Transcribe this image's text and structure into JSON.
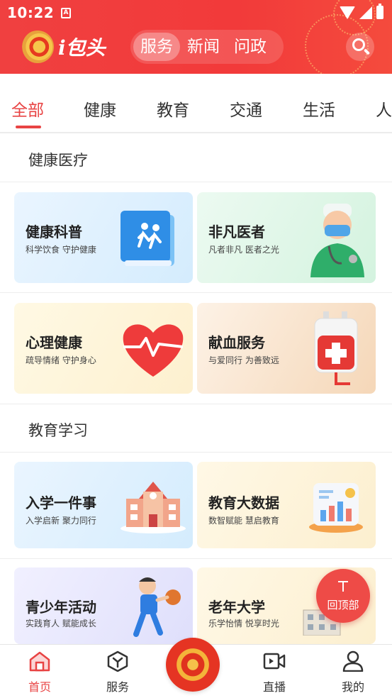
{
  "status_bar": {
    "time": "10:22",
    "notif_badge": "A"
  },
  "header": {
    "logo_text": "i包头",
    "tabs": [
      {
        "label": "服务",
        "active": true
      },
      {
        "label": "新闻",
        "active": false
      },
      {
        "label": "问政",
        "active": false
      }
    ]
  },
  "categories": [
    {
      "label": "全部",
      "active": true
    },
    {
      "label": "健康",
      "active": false
    },
    {
      "label": "教育",
      "active": false
    },
    {
      "label": "交通",
      "active": false
    },
    {
      "label": "生活",
      "active": false
    },
    {
      "label": "人",
      "active": false
    }
  ],
  "sections": {
    "health": {
      "title": "健康医疗",
      "cards": [
        {
          "title": "健康科普",
          "subtitle": "科学饮食  守护健康"
        },
        {
          "title": "非凡医者",
          "subtitle": "凡者非凡    医者之光"
        },
        {
          "title": "心理健康",
          "subtitle": "疏导情绪  守护身心"
        },
        {
          "title": "献血服务",
          "subtitle": "与爱同行  为善致远"
        }
      ]
    },
    "education": {
      "title": "教育学习",
      "cards": [
        {
          "title": "入学一件事",
          "subtitle": "入学启新  聚力同行"
        },
        {
          "title": "教育大数据",
          "subtitle": "数智赋能  慧启教育"
        },
        {
          "title": "青少年活动",
          "subtitle": "实践育人  赋能成长"
        },
        {
          "title": "老年大学",
          "subtitle": "乐学怡情  悦享时光"
        }
      ]
    }
  },
  "back_to_top": {
    "label": "回顶部"
  },
  "bottom_nav": [
    {
      "label": "首页",
      "icon": "home-icon",
      "active": true
    },
    {
      "label": "服务",
      "icon": "service-cube-icon",
      "active": false
    },
    {
      "label": "直播",
      "icon": "live-video-icon",
      "active": false
    },
    {
      "label": "我的",
      "icon": "user-icon",
      "active": false
    }
  ],
  "colors": {
    "brand_red": "#f04040",
    "accent_red": "#e84343"
  }
}
